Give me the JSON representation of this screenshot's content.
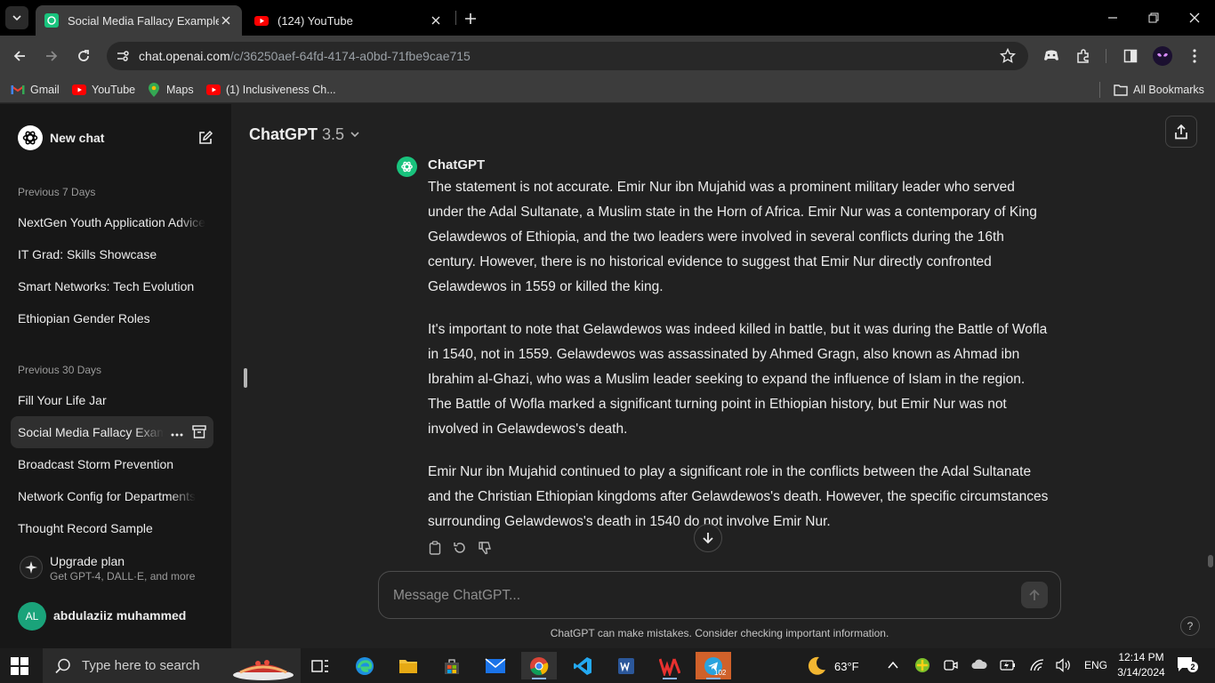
{
  "browser": {
    "tabs": [
      {
        "title": "Social Media Fallacy Examples",
        "active": true
      },
      {
        "title": "(124) YouTube",
        "active": false
      }
    ],
    "url_host": "chat.openai.com",
    "url_path": "/c/36250aef-64fd-4174-a0bd-71fbe9cae715",
    "bookmarks": [
      "Gmail",
      "YouTube",
      "Maps",
      "(1) Inclusiveness Ch..."
    ],
    "all_bookmarks": "All Bookmarks"
  },
  "sidebar": {
    "new_chat": "New chat",
    "sections": [
      {
        "label": "Previous 7 Days",
        "items": [
          "NextGen Youth Application Advice",
          "IT Grad: Skills Showcase",
          "Smart Networks: Tech Evolution",
          "Ethiopian Gender Roles"
        ]
      },
      {
        "label": "Previous 30 Days",
        "items": [
          "Fill Your Life Jar",
          "Social Media Fallacy Examples",
          "Broadcast Storm Prevention",
          "Network Config for Departments",
          "Thought Record Sample"
        ]
      }
    ],
    "upgrade": {
      "title": "Upgrade plan",
      "subtitle": "Get GPT-4, DALL·E, and more"
    },
    "user": {
      "initials": "AL",
      "name": "abdulaziiz muhammed"
    }
  },
  "chat": {
    "model": "ChatGPT",
    "model_version": "3.5",
    "assistant_name": "ChatGPT",
    "paragraphs": [
      "The statement is not accurate. Emir Nur ibn Mujahid was a prominent military leader who served under the Adal Sultanate, a Muslim state in the Horn of Africa. Emir Nur was a contemporary of King Gelawdewos of Ethiopia, and the two leaders were involved in several conflicts during the 16th century. However, there is no historical evidence to suggest that Emir Nur directly confronted Gelawdewos in 1559 or killed the king.",
      "It's important to note that Gelawdewos was indeed killed in battle, but it was during the Battle of Wofla in 1540, not in 1559. Gelawdewos was assassinated by Ahmed Gragn, also known as Ahmad ibn Ibrahim al-Ghazi, who was a Muslim leader seeking to expand the influence of Islam in the region. The Battle of Wofla marked a significant turning point in Ethiopian history, but Emir Nur was not involved in Gelawdewos's death.",
      "Emir Nur ibn Mujahid continued to play a significant role in the conflicts between the Adal Sultanate and the Christian Ethiopian kingdoms after Gelawdewos's death. However, the specific circumstances surrounding Gelawdewos's death in 1540 do not involve Emir Nur."
    ],
    "composer_placeholder": "Message ChatGPT...",
    "disclaimer": "ChatGPT can make mistakes. Consider checking important information.",
    "help": "?"
  },
  "taskbar": {
    "search_placeholder": "Type here to search",
    "telegram_badge": "102",
    "weather": "63°F",
    "lang": "ENG",
    "time": "12:14 PM",
    "date": "3/14/2024",
    "notifications": "2"
  },
  "colors": {
    "accent_green": "#19c37d",
    "avatar_green": "#1aa37a",
    "sidebar_bg": "#171717",
    "main_bg": "#212121"
  }
}
